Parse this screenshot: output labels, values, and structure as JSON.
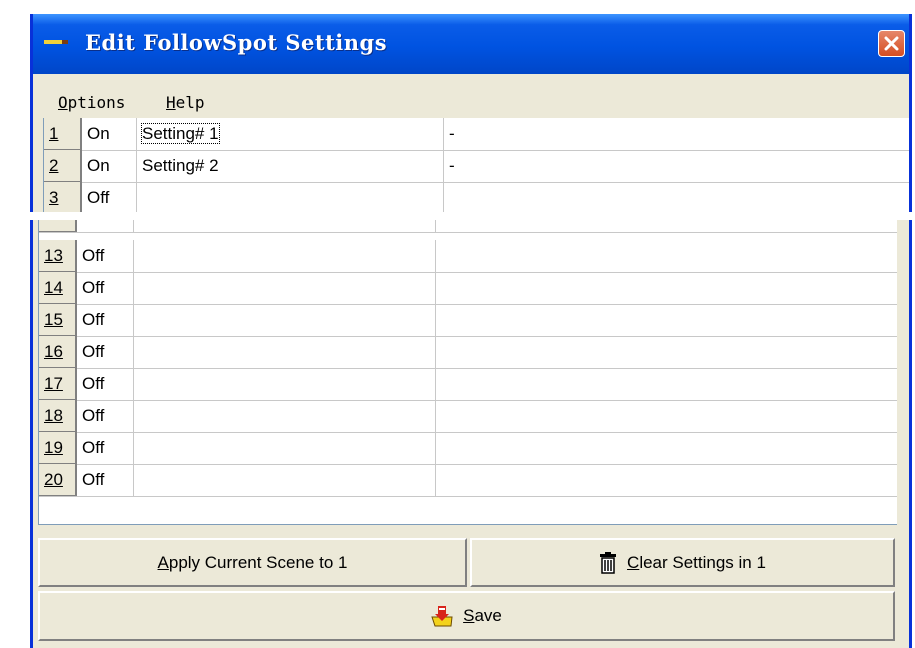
{
  "window": {
    "title": "Edit FollowSpot Settings"
  },
  "menu": [
    {
      "mnemonic": "O",
      "rest": "ptions"
    },
    {
      "mnemonic": "H",
      "rest": "elp"
    }
  ],
  "rows_top": [
    {
      "num": "1",
      "state": "On",
      "name": "Setting# 1",
      "value": "-"
    },
    {
      "num": "2",
      "state": "On",
      "name": "Setting# 2",
      "value": "-"
    },
    {
      "num": "3",
      "state": "Off",
      "name": "",
      "value": ""
    }
  ],
  "rows_bottom": [
    {
      "num": "13",
      "state": "Off"
    },
    {
      "num": "14",
      "state": "Off"
    },
    {
      "num": "15",
      "state": "Off"
    },
    {
      "num": "16",
      "state": "Off"
    },
    {
      "num": "17",
      "state": "Off"
    },
    {
      "num": "18",
      "state": "Off"
    },
    {
      "num": "19",
      "state": "Off"
    },
    {
      "num": "20",
      "state": "Off"
    }
  ],
  "buttons": {
    "apply": {
      "mnemonic": "A",
      "rest": "pply Current Scene to 1"
    },
    "clear": {
      "mnemonic": "C",
      "rest": "lear Settings in 1"
    },
    "save": {
      "mnemonic": "S",
      "rest": "ave"
    }
  },
  "icons": {
    "title": "pencil-icon",
    "close": "close-icon",
    "clear": "trash-icon",
    "save": "save-icon"
  },
  "colors": {
    "titlebar": "#0053e1",
    "frame": "#0831d9",
    "face": "#ece9d8",
    "close": "#d54e22"
  }
}
